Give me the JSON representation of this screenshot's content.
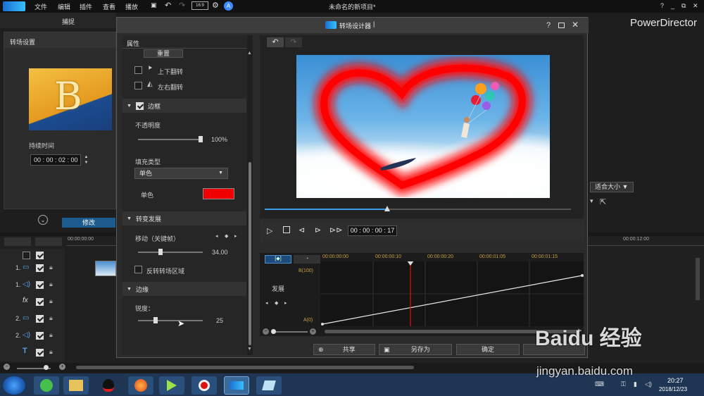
{
  "menu": {
    "file": "文件",
    "edit": "编辑",
    "plugins": "插件",
    "view": "查看",
    "play": "播放",
    "project_title": "未命名的新项目*",
    "help": "?",
    "minimize": "_",
    "restore": "⧉",
    "close": "✕"
  },
  "brand": "PowerDirector",
  "main_tabs": {
    "capture": "捕捉"
  },
  "left_panel": {
    "title": "转场设置",
    "thumb_letter": "B",
    "duration_label": "持续时间",
    "duration_value": "00 : 00 : 02 : 00"
  },
  "dialog": {
    "title": "转场设计器",
    "title_suffix": "|",
    "help": "?",
    "props": {
      "header": "属性",
      "reset": "重置",
      "flip_vertical": "上下翻转",
      "flip_horizontal": "左右翻转",
      "border": {
        "label": "边框",
        "checked": true,
        "opacity_label": "不透明度",
        "opacity_value": "100%",
        "opacity_level": 100,
        "fill_type_label": "填充类型",
        "fill_type_value": "单色",
        "color_label": "单色",
        "color": "#f00000"
      },
      "transition_develop": {
        "label": "转变发展",
        "move_label": "移动（关键帧）",
        "move_value": "34.00",
        "move_level": 34,
        "invert_label": "反转转场区域"
      },
      "edge": {
        "label": "边缘",
        "sharpness_label": "锐度：",
        "sharpness_value": "25",
        "sharpness_level": 25
      }
    },
    "player": {
      "timecode": "00 : 00 : 00 : 17",
      "progress": 0.4
    },
    "timeline": {
      "ticks": [
        "00:00:00:00",
        "00:00:00:10",
        "00:00:00:20",
        "00:00:01:05",
        "00:00:01:15"
      ],
      "track_label": "发展",
      "b_label": "B(100)",
      "a_label": "A(0)"
    },
    "buttons": {
      "share": "共享",
      "save_as": "另存为",
      "ok": "确定"
    }
  },
  "main_right": {
    "fit_size": "适合大小"
  },
  "main_timeline": {
    "modify_tab": "修改",
    "start_time": "00:00:00:00",
    "end_time": "00:00:12:00",
    "tracks": [
      "1.",
      "1.",
      "",
      "2.",
      "2.",
      ""
    ]
  },
  "taskbar": {
    "time": "20:27",
    "date": "2018/12/23"
  },
  "watermark": {
    "brand": "Baidu 经验",
    "url": "jingyan.baidu.com"
  }
}
